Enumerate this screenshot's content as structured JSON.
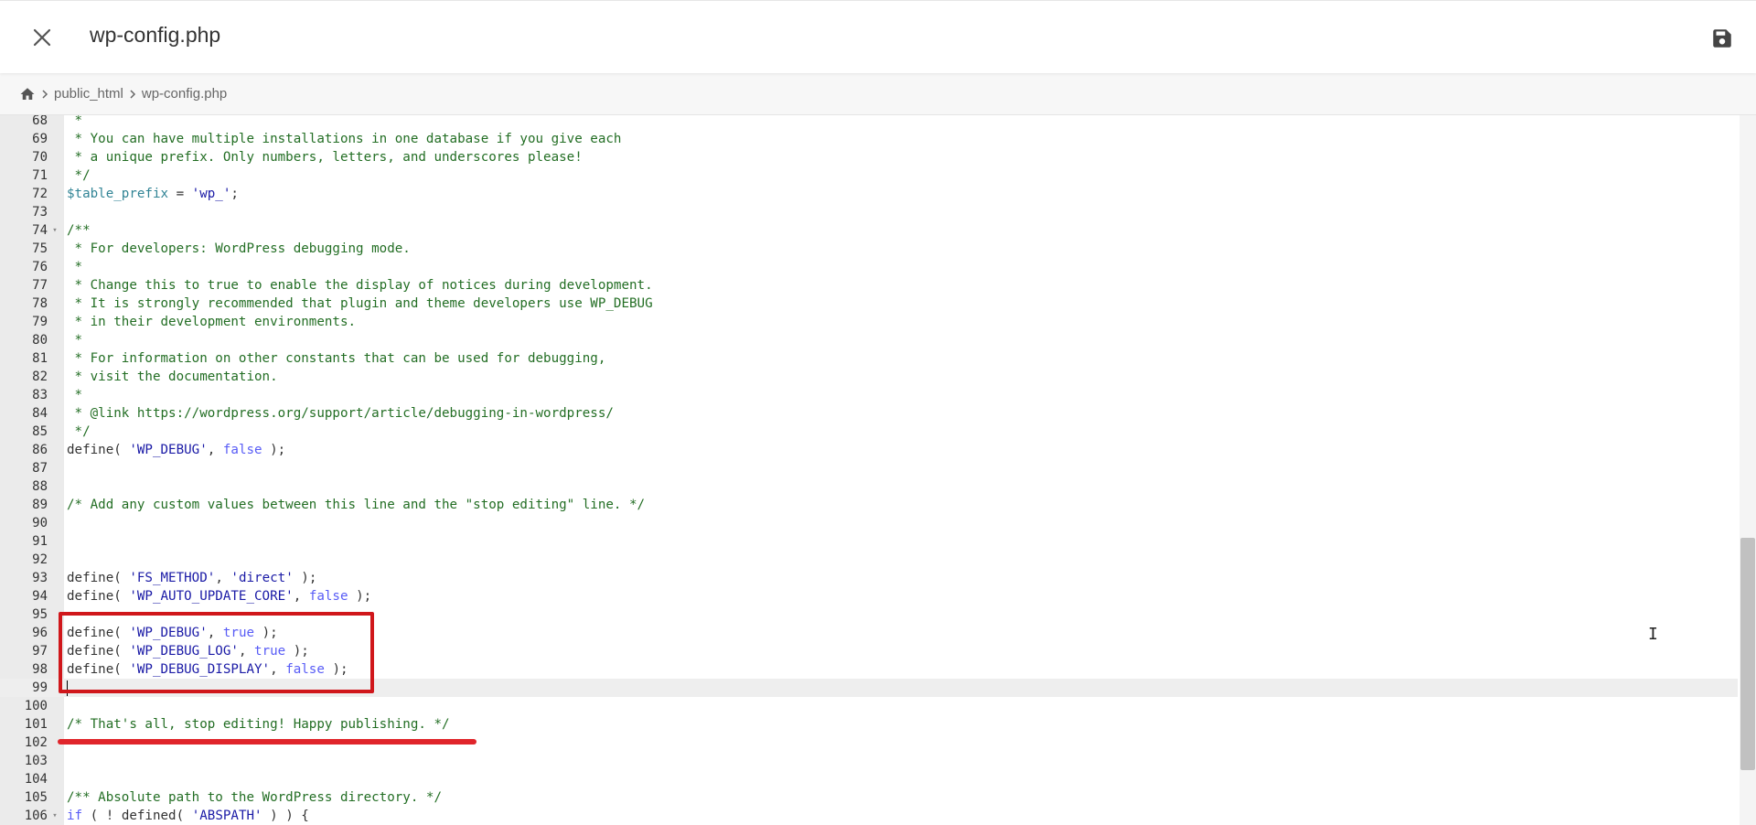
{
  "header": {
    "title": "wp-config.php",
    "close_icon": "close-icon",
    "save_icon": "save-icon"
  },
  "breadcrumb": {
    "home_icon": "home-icon",
    "items": [
      "public_html",
      "wp-config.php"
    ]
  },
  "editor": {
    "lines": [
      {
        "n": "68",
        "fold": false,
        "tokens": [
          [
            "comment",
            " *"
          ]
        ]
      },
      {
        "n": "69",
        "fold": false,
        "tokens": [
          [
            "comment",
            " * You can have multiple installations in one database if you give each"
          ]
        ]
      },
      {
        "n": "70",
        "fold": false,
        "tokens": [
          [
            "comment",
            " * a unique prefix. Only numbers, letters, and underscores please!"
          ]
        ]
      },
      {
        "n": "71",
        "fold": false,
        "tokens": [
          [
            "comment",
            " */"
          ]
        ]
      },
      {
        "n": "72",
        "fold": false,
        "tokens": [
          [
            "var",
            "$table_prefix"
          ],
          [
            "plain",
            " = "
          ],
          [
            "str",
            "'wp_'"
          ],
          [
            "plain",
            ";"
          ]
        ]
      },
      {
        "n": "73",
        "fold": false,
        "tokens": []
      },
      {
        "n": "74",
        "fold": true,
        "tokens": [
          [
            "comment",
            "/**"
          ]
        ]
      },
      {
        "n": "75",
        "fold": false,
        "tokens": [
          [
            "comment",
            " * For developers: WordPress debugging mode."
          ]
        ]
      },
      {
        "n": "76",
        "fold": false,
        "tokens": [
          [
            "comment",
            " *"
          ]
        ]
      },
      {
        "n": "77",
        "fold": false,
        "tokens": [
          [
            "comment",
            " * Change this to true to enable the display of notices during development."
          ]
        ]
      },
      {
        "n": "78",
        "fold": false,
        "tokens": [
          [
            "comment",
            " * It is strongly recommended that plugin and theme developers use WP_DEBUG"
          ]
        ]
      },
      {
        "n": "79",
        "fold": false,
        "tokens": [
          [
            "comment",
            " * in their development environments."
          ]
        ]
      },
      {
        "n": "80",
        "fold": false,
        "tokens": [
          [
            "comment",
            " *"
          ]
        ]
      },
      {
        "n": "81",
        "fold": false,
        "tokens": [
          [
            "comment",
            " * For information on other constants that can be used for debugging,"
          ]
        ]
      },
      {
        "n": "82",
        "fold": false,
        "tokens": [
          [
            "comment",
            " * visit the documentation."
          ]
        ]
      },
      {
        "n": "83",
        "fold": false,
        "tokens": [
          [
            "comment",
            " *"
          ]
        ]
      },
      {
        "n": "84",
        "fold": false,
        "tokens": [
          [
            "comment",
            " * @link https://wordpress.org/support/article/debugging-in-wordpress/"
          ]
        ]
      },
      {
        "n": "85",
        "fold": false,
        "tokens": [
          [
            "comment",
            " */"
          ]
        ]
      },
      {
        "n": "86",
        "fold": false,
        "tokens": [
          [
            "fn",
            "define"
          ],
          [
            "plain",
            "( "
          ],
          [
            "str",
            "'WP_DEBUG'"
          ],
          [
            "plain",
            ", "
          ],
          [
            "kw",
            "false"
          ],
          [
            "plain",
            " );"
          ]
        ]
      },
      {
        "n": "87",
        "fold": false,
        "tokens": []
      },
      {
        "n": "88",
        "fold": false,
        "tokens": []
      },
      {
        "n": "89",
        "fold": false,
        "tokens": [
          [
            "comment",
            "/* Add any custom values between this line and the \"stop editing\" line. */"
          ]
        ]
      },
      {
        "n": "90",
        "fold": false,
        "tokens": []
      },
      {
        "n": "91",
        "fold": false,
        "tokens": []
      },
      {
        "n": "92",
        "fold": false,
        "tokens": []
      },
      {
        "n": "93",
        "fold": false,
        "tokens": [
          [
            "fn",
            "define"
          ],
          [
            "plain",
            "( "
          ],
          [
            "str",
            "'FS_METHOD'"
          ],
          [
            "plain",
            ", "
          ],
          [
            "str",
            "'direct'"
          ],
          [
            "plain",
            " );"
          ]
        ]
      },
      {
        "n": "94",
        "fold": false,
        "tokens": [
          [
            "fn",
            "define"
          ],
          [
            "plain",
            "( "
          ],
          [
            "str",
            "'WP_AUTO_UPDATE_CORE'"
          ],
          [
            "plain",
            ", "
          ],
          [
            "kw",
            "false"
          ],
          [
            "plain",
            " );"
          ]
        ]
      },
      {
        "n": "95",
        "fold": false,
        "tokens": []
      },
      {
        "n": "96",
        "fold": false,
        "tokens": [
          [
            "fn",
            "define"
          ],
          [
            "plain",
            "( "
          ],
          [
            "str",
            "'WP_DEBUG'"
          ],
          [
            "plain",
            ", "
          ],
          [
            "kw",
            "true"
          ],
          [
            "plain",
            " );"
          ]
        ]
      },
      {
        "n": "97",
        "fold": false,
        "tokens": [
          [
            "fn",
            "define"
          ],
          [
            "plain",
            "( "
          ],
          [
            "str",
            "'WP_DEBUG_LOG'"
          ],
          [
            "plain",
            ", "
          ],
          [
            "kw",
            "true"
          ],
          [
            "plain",
            " );"
          ]
        ]
      },
      {
        "n": "98",
        "fold": false,
        "tokens": [
          [
            "fn",
            "define"
          ],
          [
            "plain",
            "( "
          ],
          [
            "str",
            "'WP_DEBUG_DISPLAY'"
          ],
          [
            "plain",
            ", "
          ],
          [
            "kw",
            "false"
          ],
          [
            "plain",
            " );"
          ]
        ]
      },
      {
        "n": "99",
        "fold": false,
        "active": true,
        "tokens": []
      },
      {
        "n": "100",
        "fold": false,
        "tokens": []
      },
      {
        "n": "101",
        "fold": false,
        "tokens": [
          [
            "comment",
            "/* That's all, stop editing! Happy publishing. */"
          ]
        ]
      },
      {
        "n": "102",
        "fold": false,
        "tokens": []
      },
      {
        "n": "103",
        "fold": false,
        "tokens": []
      },
      {
        "n": "104",
        "fold": false,
        "tokens": []
      },
      {
        "n": "105",
        "fold": false,
        "tokens": [
          [
            "comment",
            "/** Absolute path to the WordPress directory. */"
          ]
        ]
      },
      {
        "n": "106",
        "fold": true,
        "tokens": [
          [
            "kw",
            "if"
          ],
          [
            "plain",
            " ( ! "
          ],
          [
            "fn",
            "defined"
          ],
          [
            "plain",
            "( "
          ],
          [
            "str",
            "'ABSPATH'"
          ],
          [
            "plain",
            " ) ) {"
          ]
        ]
      }
    ]
  },
  "annotations": {
    "highlight_color": "#d0171b",
    "underline_color": "#e0252b"
  }
}
